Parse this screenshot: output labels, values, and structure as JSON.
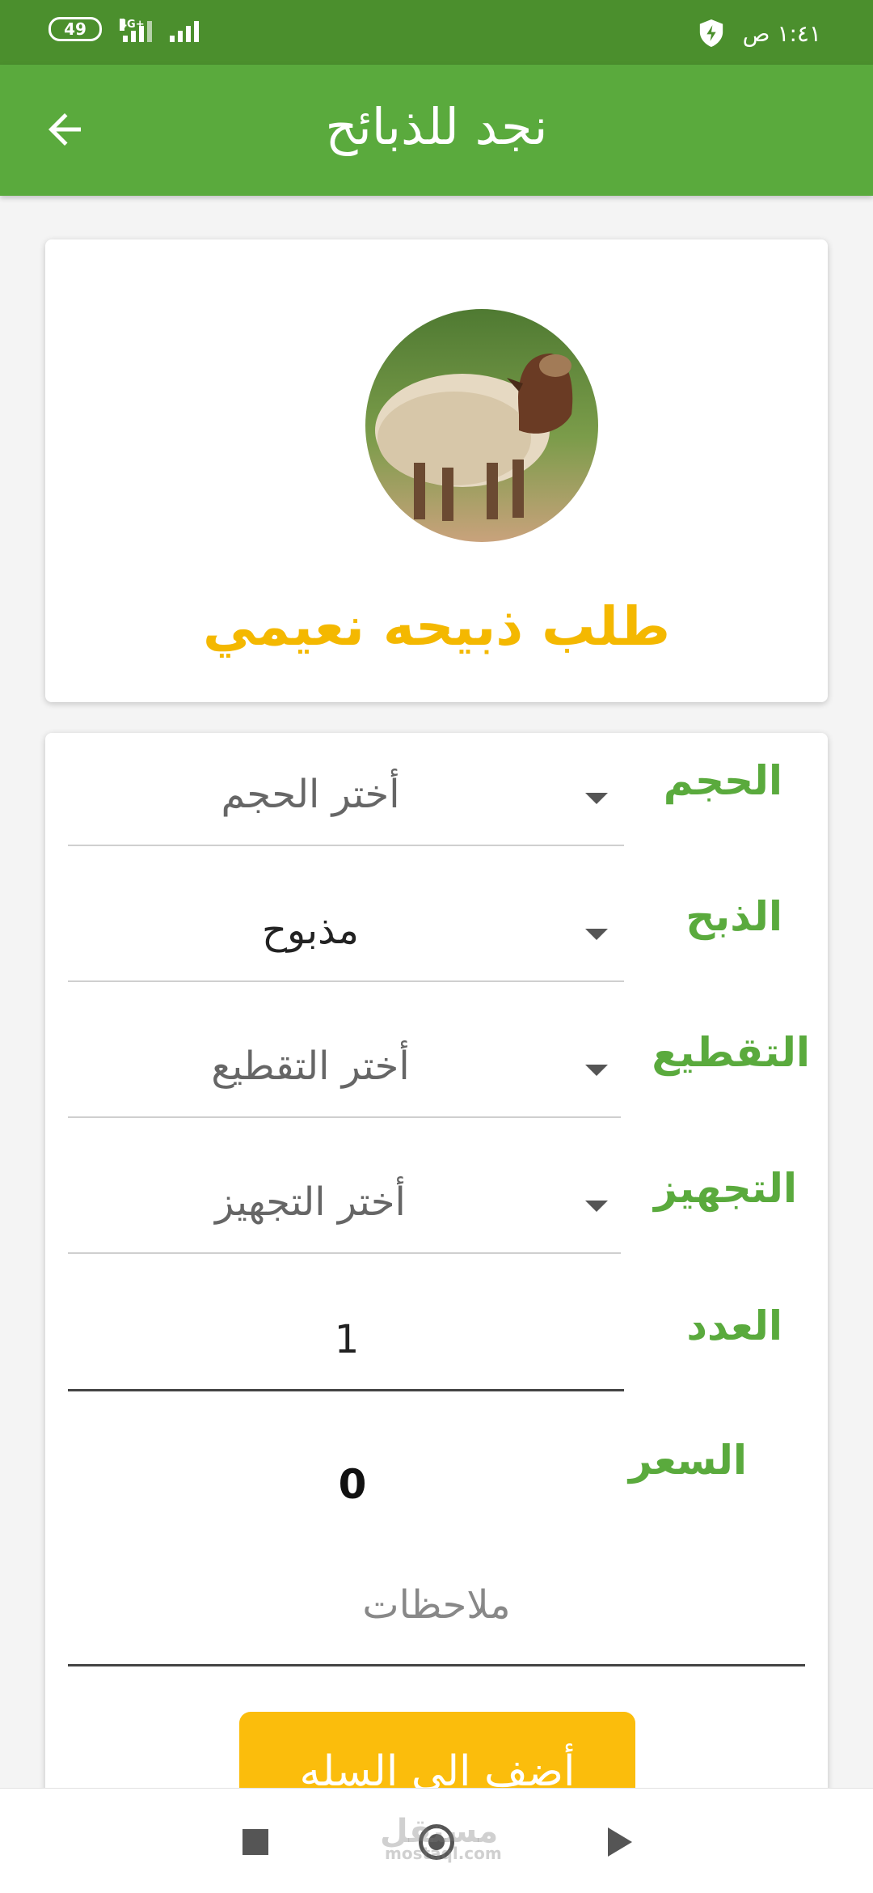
{
  "status_bar": {
    "battery": "49",
    "network": "4G+",
    "time": "١:٤١ ص"
  },
  "app_bar": {
    "title": "نجد للذبائح"
  },
  "product": {
    "title": "طلب ذبيحه نعيمي"
  },
  "form": {
    "size": {
      "label": "الحجم",
      "value": "أختر الحجم"
    },
    "slaughter": {
      "label": "الذبح",
      "value": "مذبوح"
    },
    "cutting": {
      "label": "التقطيع",
      "value": "أختر التقطيع"
    },
    "preparation": {
      "label": "التجهيز",
      "value": "أختر التجهيز"
    },
    "quantity": {
      "label": "العدد",
      "value": "1"
    },
    "price": {
      "label": "السعر",
      "value": "0"
    },
    "notes": {
      "placeholder": "ملاحظات"
    },
    "add_button": "أضف الى السله"
  },
  "watermark": {
    "text": "مستقل",
    "sub": "mostaql.com"
  }
}
